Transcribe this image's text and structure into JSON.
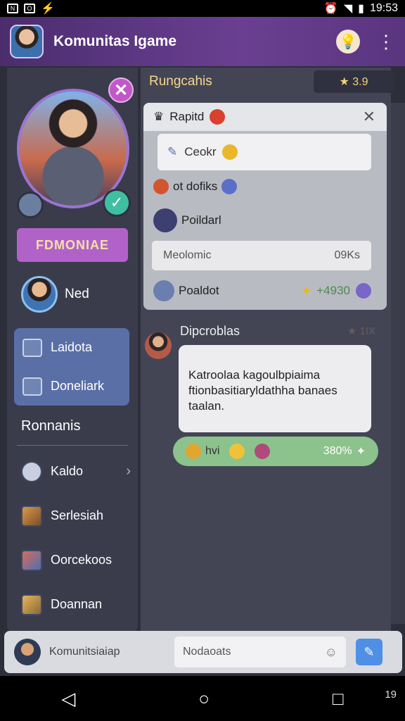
{
  "status": {
    "time": "19:53"
  },
  "appbar": {
    "title": "Komunitas Igame"
  },
  "profile": {
    "badge_label": "FDMONIAE",
    "user_name": "Ned"
  },
  "nav": [
    {
      "label": "Laidota"
    },
    {
      "label": "Doneliark"
    }
  ],
  "sidebar": {
    "section_title": "Ronnanis",
    "menu": [
      {
        "label": "Kaldo"
      },
      {
        "label": "Serlesiah"
      },
      {
        "label": "Oorcekoos"
      },
      {
        "label": "Doannan"
      }
    ]
  },
  "main": {
    "title": "Rungcahis",
    "score": "★ 3.9",
    "card": {
      "title": "Rapitd",
      "input_text": "Ceokr",
      "row1": "ot  dofiks",
      "user_row": "Poildarl",
      "search_left": "Meolomic",
      "search_right": "09Ks",
      "bottom_row": "Poaldot",
      "bottom_score": "+4930"
    },
    "chat": {
      "header": "Dipcroblas",
      "rank": "★ 1IX",
      "message": "Katroolaa kagoulbpiaima ftionbasitiaryldathha banaes taalan.",
      "reaction_label": "hvi",
      "reaction_pct": "380%"
    }
  },
  "bottom": {
    "label": "Komunitsiaiap",
    "input": "Nodaoats"
  },
  "navbar": {
    "time": "19"
  }
}
